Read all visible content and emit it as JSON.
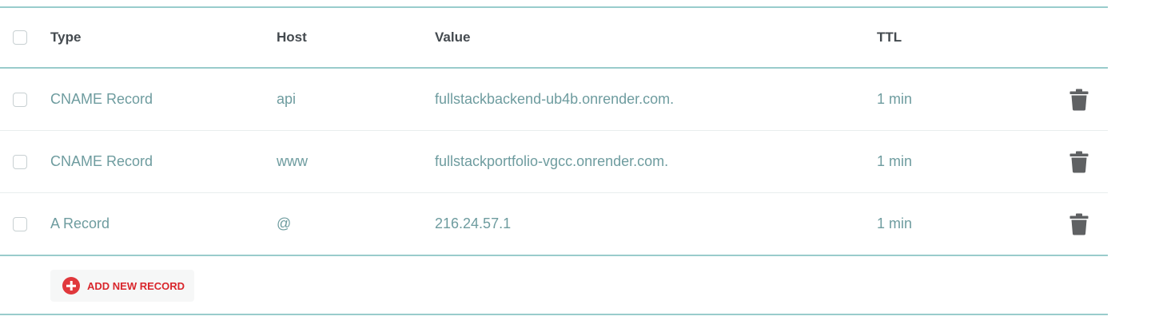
{
  "table": {
    "headers": {
      "type": "Type",
      "host": "Host",
      "value": "Value",
      "ttl": "TTL"
    },
    "records": [
      {
        "type": "CNAME Record",
        "host": "api",
        "value": "fullstackbackend-ub4b.onrender.com.",
        "ttl": "1 min"
      },
      {
        "type": "CNAME Record",
        "host": "www",
        "value": "fullstackportfolio-vgcc.onrender.com.",
        "ttl": "1 min"
      },
      {
        "type": "A Record",
        "host": "@",
        "value": "216.24.57.1",
        "ttl": "1 min"
      }
    ]
  },
  "actions": {
    "add_record_label": "ADD NEW RECORD",
    "delete_icon": "trash-icon",
    "add_icon": "plus-circle-icon"
  },
  "colors": {
    "accent_border": "#99cccc",
    "record_text": "#6e9c9f",
    "add_red": "#e0383c"
  }
}
